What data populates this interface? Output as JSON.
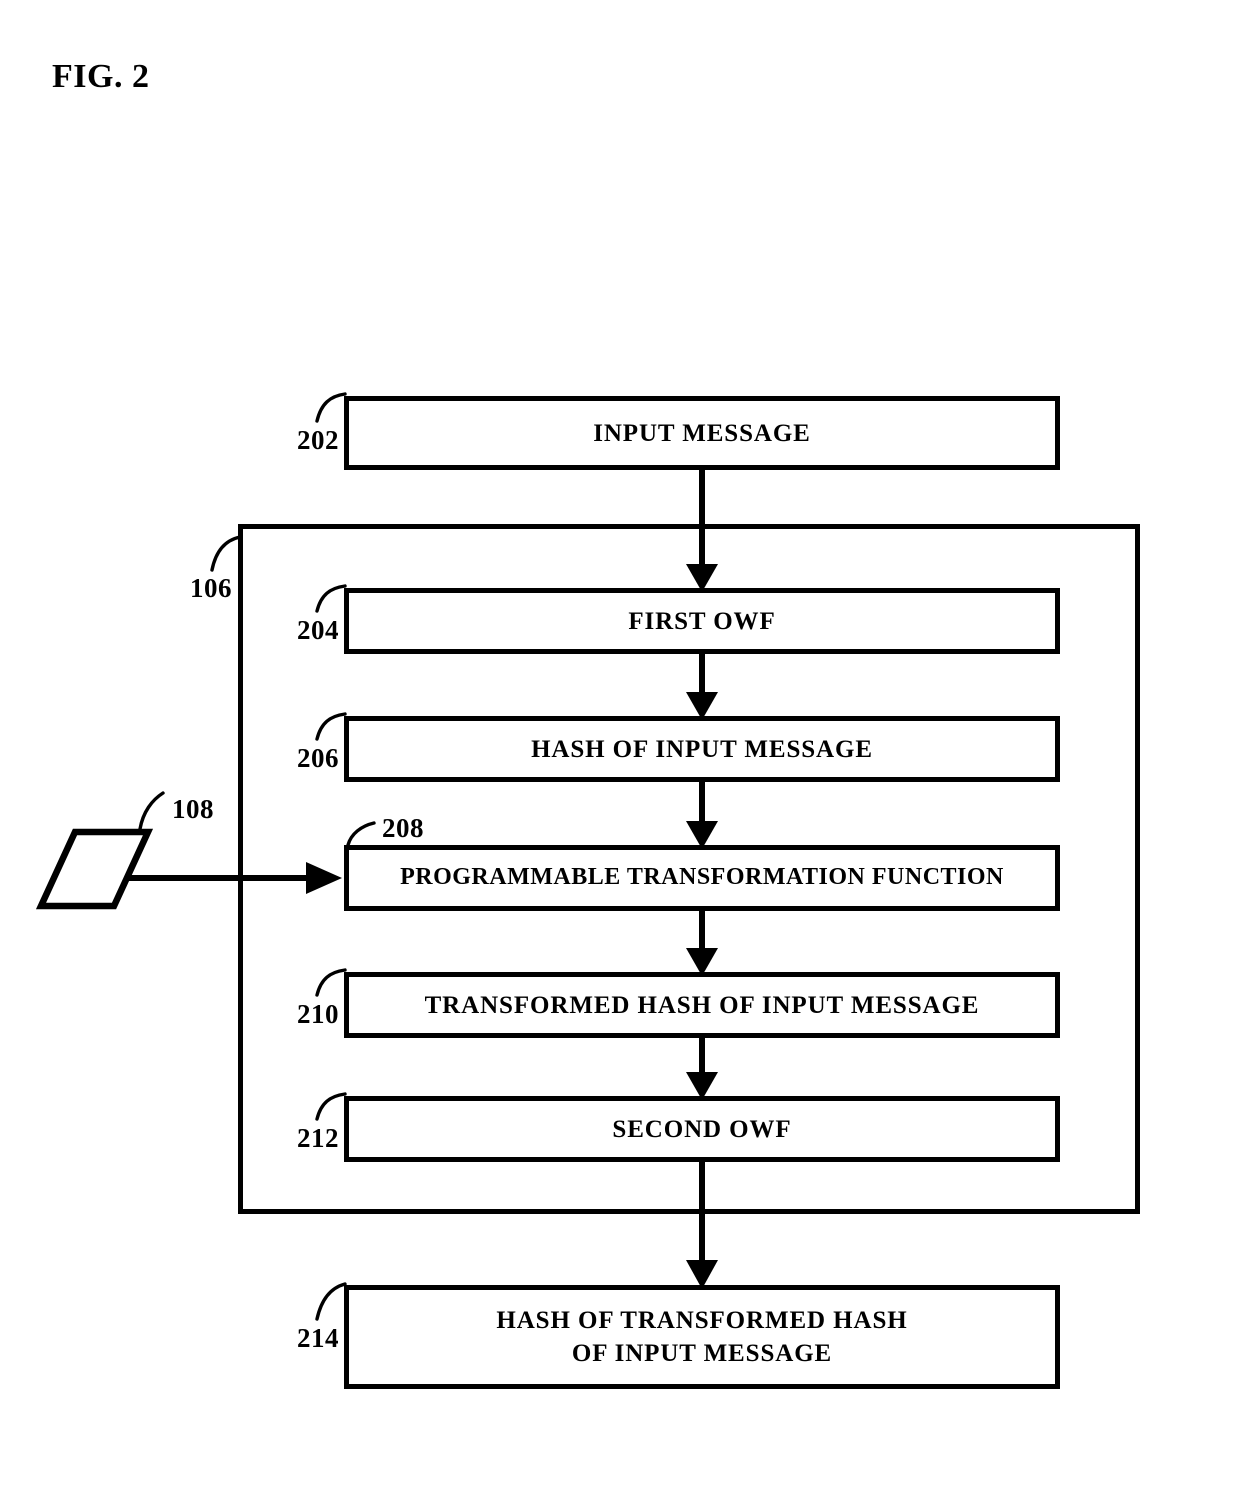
{
  "figure": {
    "title": "FIG. 2"
  },
  "container": {
    "ref": "106"
  },
  "external_input": {
    "ref": "108",
    "shape": "parallelogram"
  },
  "boxes": [
    {
      "ref": "202",
      "label": "INPUT MESSAGE"
    },
    {
      "ref": "204",
      "label": "FIRST OWF"
    },
    {
      "ref": "206",
      "label": "HASH OF INPUT MESSAGE"
    },
    {
      "ref": "208",
      "label": "PROGRAMMABLE TRANSFORMATION FUNCTION"
    },
    {
      "ref": "210",
      "label": "TRANSFORMED HASH OF INPUT MESSAGE"
    },
    {
      "ref": "212",
      "label": "SECOND OWF"
    },
    {
      "ref": "214",
      "label": "HASH OF TRANSFORMED HASH\nOF INPUT MESSAGE"
    }
  ],
  "colors": {
    "ink": "#000000",
    "paper": "#ffffff"
  }
}
